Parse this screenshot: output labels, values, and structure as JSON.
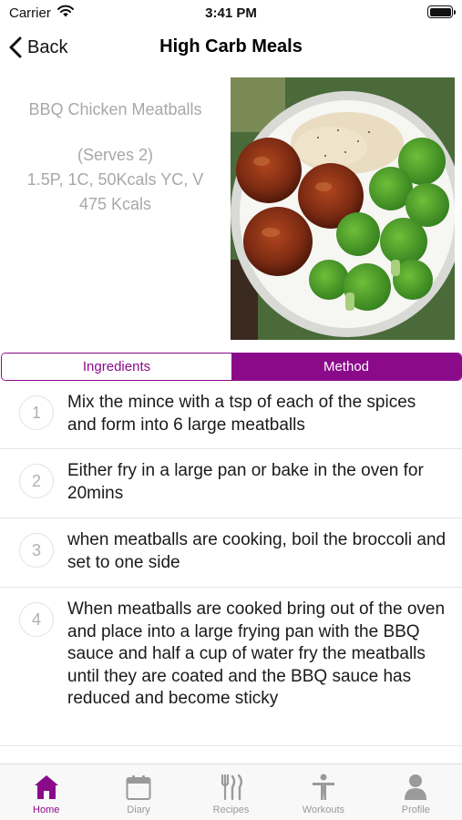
{
  "status_bar": {
    "carrier": "Carrier",
    "time": "3:41 PM"
  },
  "nav": {
    "back_label": "Back",
    "title": "High Carb Meals"
  },
  "recipe": {
    "name": "BBQ Chicken Meatballs",
    "serves": "(Serves 2)",
    "macros": "1.5P, 1C, 50Kcals YC, V",
    "kcals": "475 Kcals"
  },
  "segments": {
    "ingredients": "Ingredients",
    "method": "Method",
    "selected": "Method"
  },
  "steps": [
    {
      "number": "1",
      "text": "Mix the mince with a tsp of each of the spices and form into 6 large meatballs"
    },
    {
      "number": "2",
      "text": "Either fry in a large pan or bake in the oven for 20mins"
    },
    {
      "number": "3",
      "text": "when meatballs are cooking, boil the broccoli and set to one side"
    },
    {
      "number": "4",
      "text": "When meatballs are cooked bring out of the oven and place into a large frying pan with the BBQ sauce and half a cup of water fry the meatballs until they are coated and the BBQ sauce has reduced and become sticky"
    }
  ],
  "tab_bar": {
    "home": "Home",
    "diary": "Diary",
    "recipes": "Recipes",
    "workouts": "Workouts",
    "profile": "Profile",
    "active": "Home"
  },
  "colors": {
    "accent": "#8a0a8a",
    "muted_text": "#a8a8a8",
    "inactive_tab": "#9a9a9a"
  },
  "icons": [
    "wifi-icon",
    "battery-icon",
    "chevron-left-icon",
    "home-icon",
    "calendar-icon",
    "cutlery-icon",
    "person-icon",
    "user-icon"
  ]
}
